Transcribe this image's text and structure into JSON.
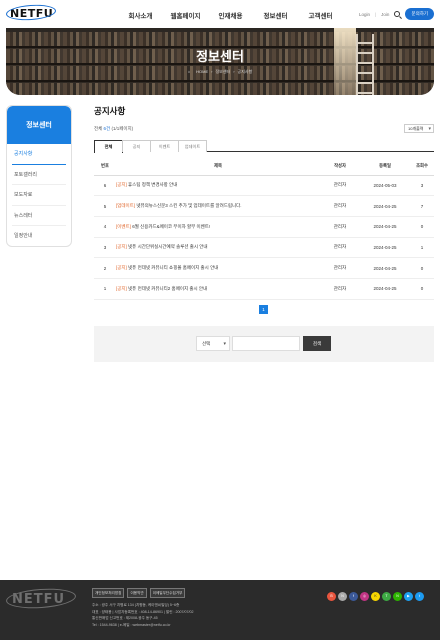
{
  "header": {
    "logo": "NETFU",
    "nav": [
      "회사소개",
      "웹홈페이지",
      "인재채용",
      "정보센터",
      "고객센터"
    ],
    "login": "Login",
    "join": "Join",
    "contact_button": "문의하기"
  },
  "banner": {
    "title": "정보센터",
    "breadcrumb": [
      "HOME",
      "정보센터",
      "공지사항"
    ]
  },
  "sidebar": {
    "title": "정보센터",
    "items": [
      {
        "label": "공지사항",
        "active": true
      },
      {
        "label": "포토갤러리",
        "active": false
      },
      {
        "label": "보도자료",
        "active": false
      },
      {
        "label": "뉴스레터",
        "active": false
      },
      {
        "label": "일정안내",
        "active": false
      }
    ]
  },
  "main": {
    "title": "공지사항",
    "total_prefix": "전체",
    "total_count": "6건",
    "total_pages": "(1/1페이지)",
    "per_page": "10개출력",
    "tabs": [
      {
        "label": "전체",
        "active": true
      },
      {
        "label": "공지",
        "active": false
      },
      {
        "label": "이벤트",
        "active": false
      },
      {
        "label": "업데이트",
        "active": false
      }
    ],
    "columns": [
      "번호",
      "제목",
      "작성자",
      "등록일",
      "조회수"
    ],
    "rows": [
      {
        "num": "6",
        "category": "[공지]",
        "title": "휴스팀 정책 변경사항 안내",
        "writer": "관리자",
        "date": "2024-05-03",
        "views": "3"
      },
      {
        "num": "5",
        "category": "[업데이트]",
        "title": "넷퓨의뉴스신문3 스킨 추가 및 업데이트를 알려드립니다.",
        "writer": "관리자",
        "date": "2024-04-25",
        "views": "7"
      },
      {
        "num": "4",
        "category": "[이벤트]",
        "title": "6월 신용카드&페이코 무이자 할부 이벤트!",
        "writer": "관리자",
        "date": "2024-04-25",
        "views": "0"
      },
      {
        "num": "3",
        "category": "[공지]",
        "title": "넷퓨 시간단위실시간예약 솔루션 출시 안내",
        "writer": "관리자",
        "date": "2024-04-25",
        "views": "1"
      },
      {
        "num": "2",
        "category": "[공지]",
        "title": "넷퓨 먼데넷 커뮤니티 쇼핑몰 홈페이지 출시 안내",
        "writer": "관리자",
        "date": "2024-04-25",
        "views": "0"
      },
      {
        "num": "1",
        "category": "[공지]",
        "title": "넷퓨 먼데넷 커뮤니티2 홈페이지 출시 안내",
        "writer": "관리자",
        "date": "2024-04-25",
        "views": "0"
      }
    ],
    "current_page": "1",
    "search": {
      "select_label": "선택",
      "input_placeholder": "",
      "button_label": "검색"
    }
  },
  "footer": {
    "logo": "NETFU",
    "links": [
      "개인정보처리방침",
      "이용약관",
      "이메일무단수집거부"
    ],
    "info_lines": [
      "주소 : 광주 서구 치평로 134 (치평동, 케이앤씨빌딩) 5~6층",
      "대표 : 양태용 | 사업자등록번호 : 408-14-86901 | 팔린 : 2007/07/02",
      "통신판매업 신고번호 : 제2008-광주 동구-45",
      "Tel : 1544-9638 | e-메일 : webmaster@netfu.co.kr"
    ],
    "sns": [
      {
        "icon": "blog-icon",
        "color": "#e8553e",
        "text": "B"
      },
      {
        "icon": "band-icon",
        "color": "#a8a8a8",
        "text": "N"
      },
      {
        "icon": "facebook-icon",
        "color": "#3b5998",
        "text": "f"
      },
      {
        "icon": "instagram-icon",
        "color": "#c13584",
        "text": "◎"
      },
      {
        "icon": "kakao-icon",
        "color": "#f7d600",
        "text": "K"
      },
      {
        "icon": "talk-icon",
        "color": "#3da944",
        "text": "T"
      },
      {
        "icon": "naver-icon",
        "color": "#2db400",
        "text": "N"
      },
      {
        "icon": "youtube-icon",
        "color": "#1da1f2",
        "text": "▶"
      },
      {
        "icon": "twitter-icon",
        "color": "#1d9bf0",
        "text": "t"
      }
    ]
  },
  "colors": {
    "accent": "#1a7fe0",
    "category": "#e0652a",
    "footer_bg": "#2b2b2b"
  }
}
